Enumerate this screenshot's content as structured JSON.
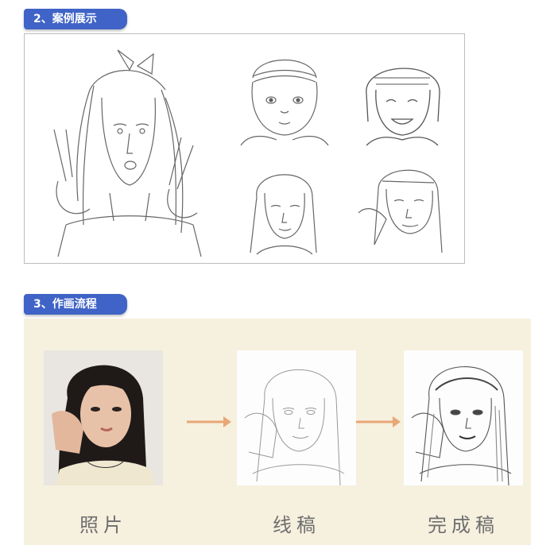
{
  "sections": {
    "case_title": "2、案例展示",
    "process_title": "3、作画流程"
  },
  "process": {
    "steps": [
      {
        "label": "照片"
      },
      {
        "label": "线稿"
      },
      {
        "label": "完成稿"
      }
    ]
  },
  "colors": {
    "tag_blue": "#3f63c6",
    "panel_beige": "#f6f0df",
    "arrow_orange": "#e8a777"
  }
}
